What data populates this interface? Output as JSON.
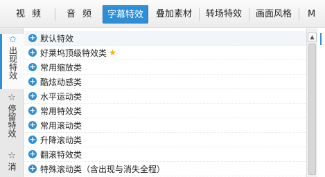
{
  "tabs": [
    {
      "label": "视频"
    },
    {
      "label": "音频"
    },
    {
      "label": "字幕特效",
      "active": true
    },
    {
      "label": "叠加素材"
    },
    {
      "label": "转场特效"
    },
    {
      "label": "画面风格"
    },
    {
      "label": "M T"
    }
  ],
  "rail": [
    {
      "icon": "appear-star-icon",
      "label": "出现特效",
      "active": true
    },
    {
      "icon": "stay-star-icon",
      "label": "停留特效"
    },
    {
      "icon": "disappear-star-icon",
      "label": "消"
    }
  ],
  "effects": [
    {
      "label": "默认特效"
    },
    {
      "label": "好莱坞顶级特效类",
      "starred": true
    },
    {
      "label": "常用缩放类"
    },
    {
      "label": "酷炫动感类"
    },
    {
      "label": "水平运动类"
    },
    {
      "label": "常用特效类"
    },
    {
      "label": "常用滚动类"
    },
    {
      "label": "升降滚动类"
    },
    {
      "label": "翻滚特效类"
    },
    {
      "label": "特殊滚动类（含出现与消失全程）"
    }
  ],
  "colors": {
    "accent": "#2e8fd6",
    "star": "#f0b400"
  }
}
